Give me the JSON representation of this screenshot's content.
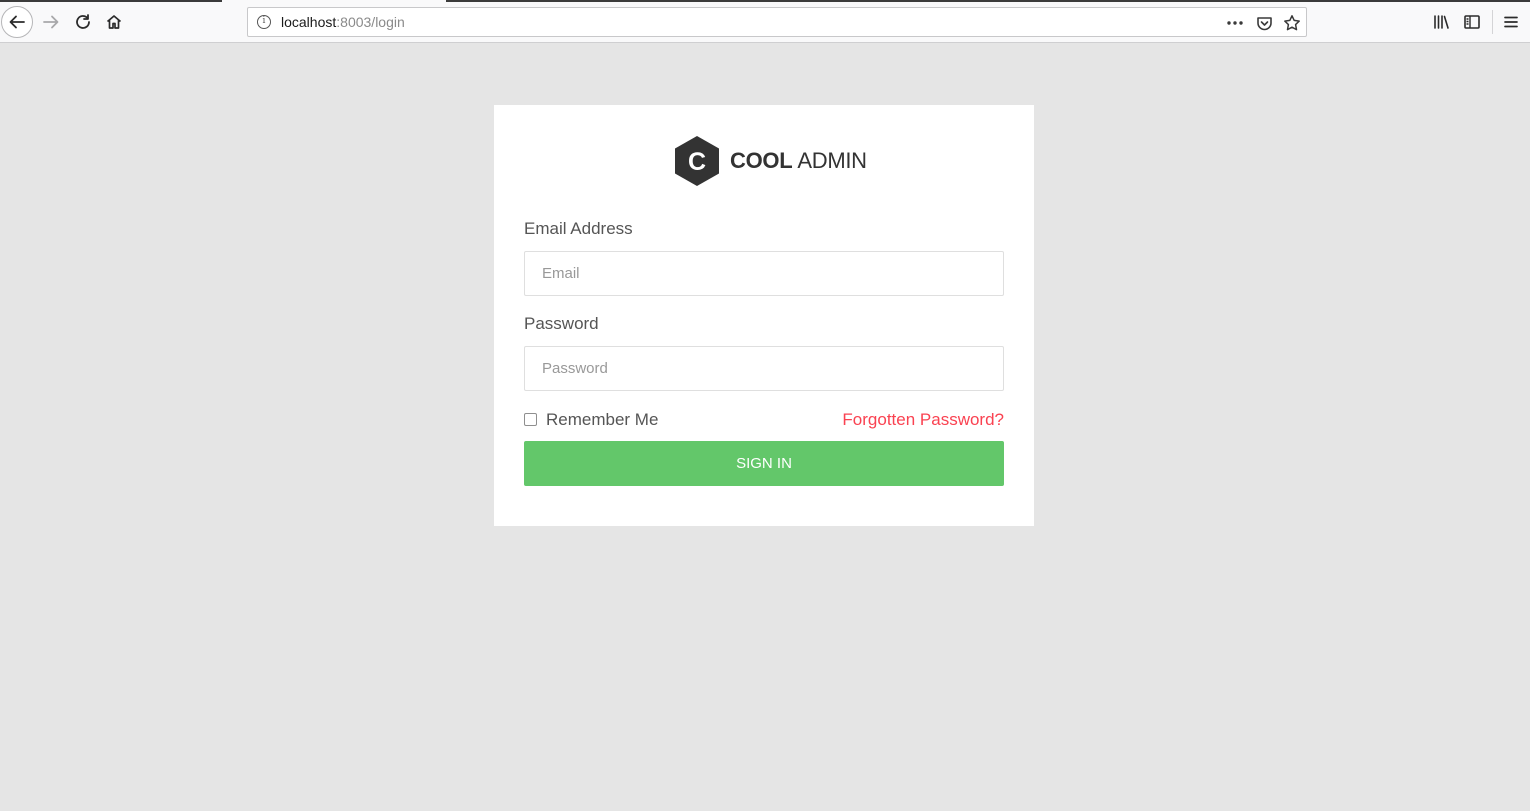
{
  "browser": {
    "url_host": "localhost",
    "url_path": ":8003/login",
    "icons": [
      "back-arrow-icon",
      "forward-arrow-icon",
      "reload-icon",
      "home-icon",
      "info-icon",
      "more-dots-icon",
      "pocket-icon",
      "star-icon",
      "library-icon",
      "sidebar-icon",
      "hamburger-menu-icon"
    ]
  },
  "logo": {
    "mark_letter": "C",
    "word_bold": "COOL",
    "word_regular": "ADMIN",
    "color": "#333333"
  },
  "form": {
    "email_label": "Email Address",
    "email_placeholder": "Email",
    "email_value": "",
    "password_label": "Password",
    "password_placeholder": "Password",
    "password_value": "",
    "remember_label": "Remember Me",
    "remember_checked": false,
    "forgot_link": "Forgotten Password?",
    "submit_label": "SIGN IN"
  },
  "colors": {
    "page_background": "#e5e5e5",
    "card_background": "#ffffff",
    "submit_button": "#63c76a",
    "forgot_link": "#fa4251"
  }
}
